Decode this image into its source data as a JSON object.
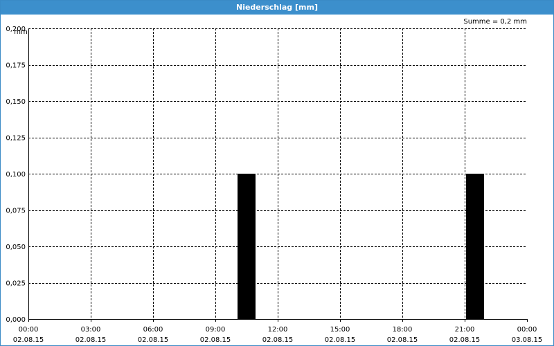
{
  "window": {
    "title": "Niederschlag [mm]"
  },
  "summary": {
    "label": "Summe = 0,2 mm"
  },
  "chart_data": {
    "type": "bar",
    "title": "Niederschlag [mm]",
    "ylabel": "mm",
    "ylim": [
      0,
      0.2
    ],
    "y_ticks": [
      "0,000",
      "0,025",
      "0,050",
      "0,075",
      "0,100",
      "0,125",
      "0,150",
      "0,175",
      "0,200"
    ],
    "x_ticks": [
      {
        "time": "00:00",
        "date": "02.08.15"
      },
      {
        "time": "03:00",
        "date": "02.08.15"
      },
      {
        "time": "06:00",
        "date": "02.08.15"
      },
      {
        "time": "09:00",
        "date": "02.08.15"
      },
      {
        "time": "12:00",
        "date": "02.08.15"
      },
      {
        "time": "15:00",
        "date": "02.08.15"
      },
      {
        "time": "18:00",
        "date": "02.08.15"
      },
      {
        "time": "21:00",
        "date": "02.08.15"
      },
      {
        "time": "00:00",
        "date": "03.08.15"
      }
    ],
    "x_range_hours": [
      0,
      24
    ],
    "bars": [
      {
        "start": "02.08.15 10:00",
        "end": "02.08.15 11:00",
        "value": 0.1
      },
      {
        "start": "02.08.15 21:00",
        "end": "02.08.15 22:00",
        "value": 0.1
      }
    ],
    "bar_color": "#000000",
    "grid": true
  }
}
